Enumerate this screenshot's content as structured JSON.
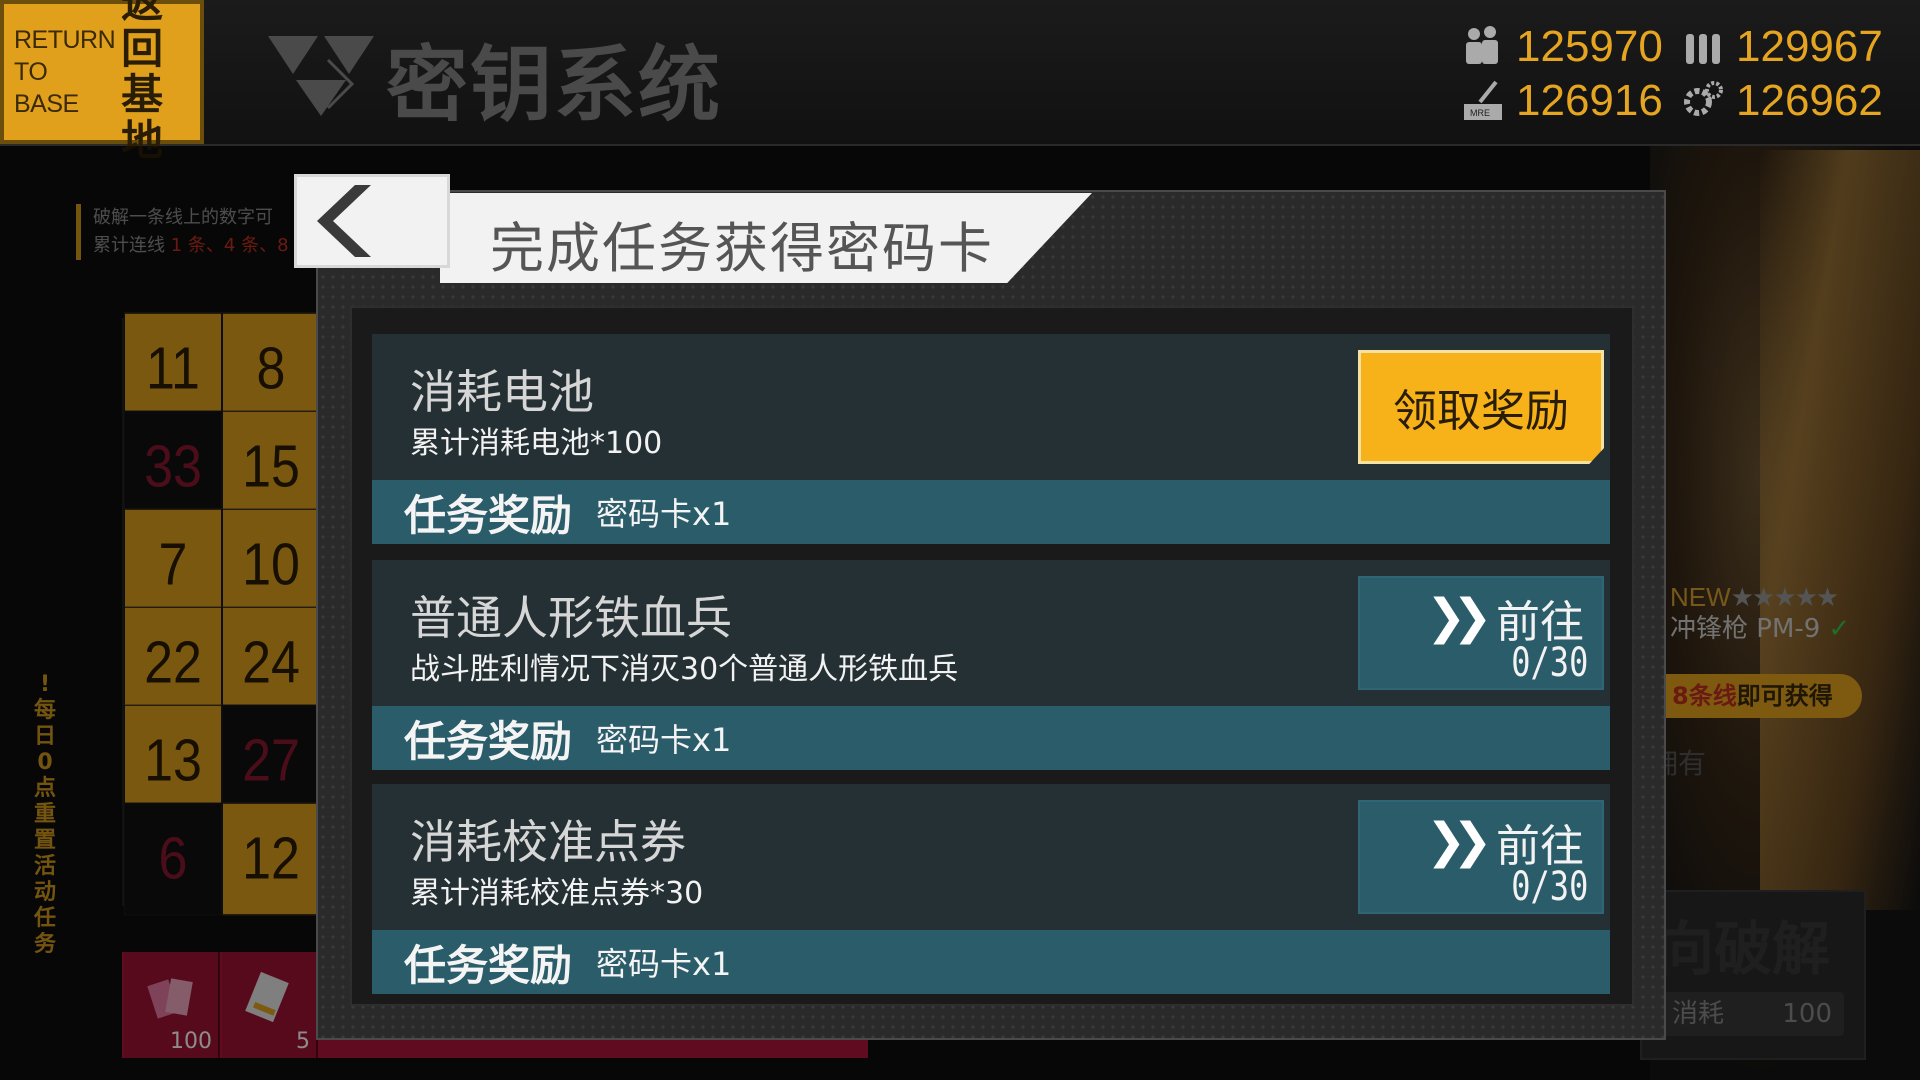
{
  "topbar": {
    "return_en": "RETURN TO BASE",
    "return_en_l1": "RETURN",
    "return_en_l2": "TO BASE",
    "return_cn_l1": "返回",
    "return_cn_l2": "基地",
    "title": "密钥系统",
    "resources": [
      {
        "icon": "manpower-icon",
        "value": "125970"
      },
      {
        "icon": "ammo-icon",
        "value": "129967"
      },
      {
        "icon": "ration-icon",
        "value": "126916"
      },
      {
        "icon": "parts-icon",
        "value": "126962"
      }
    ]
  },
  "background": {
    "hint_l1": "破解一条线上的数字可",
    "hint_l2_a": "累计连线 ",
    "hint_l2_b": "1 条、4 条、8",
    "grid": [
      [
        "11",
        "8"
      ],
      [
        "33",
        "15"
      ],
      [
        "7",
        "10"
      ],
      [
        "22",
        "24"
      ],
      [
        "13",
        "27"
      ],
      [
        "6",
        "12"
      ]
    ],
    "daily_reset": "每日0点重置活动任务",
    "bottom_slots": [
      {
        "icon": "ticket-icon",
        "count": "100"
      },
      {
        "icon": "card-icon",
        "count": "5"
      }
    ],
    "gun_new": "NEW",
    "gun_stars": "★★★★★",
    "gun_name": "冲锋枪 PM-9",
    "gain_red": "8条线",
    "gain_rest": "即可获得",
    "owned": "拥有",
    "crack_title": "向破解",
    "crack_cost_label": "消耗",
    "crack_cost_value": "100"
  },
  "modal": {
    "title": "完成任务获得密码卡",
    "tasks": [
      {
        "name": "消耗电池",
        "desc": "累计消耗电池*100",
        "reward_label": "任务奖励",
        "reward": "密码卡x1",
        "action": "领取奖励",
        "progress": ""
      },
      {
        "name": "普通人形铁血兵",
        "desc": "战斗胜利情况下消灭30个普通人形铁血兵",
        "reward_label": "任务奖励",
        "reward": "密码卡x1",
        "action": "前往",
        "progress": "0/30"
      },
      {
        "name": "消耗校准点券",
        "desc": "累计消耗校准点券*30",
        "reward_label": "任务奖励",
        "reward": "密码卡x1",
        "action": "前往",
        "progress": "0/30"
      }
    ]
  },
  "colors": {
    "accent": "#f7b21a",
    "task_bg": "#243033",
    "reward_bar": "#2a5c6a"
  }
}
